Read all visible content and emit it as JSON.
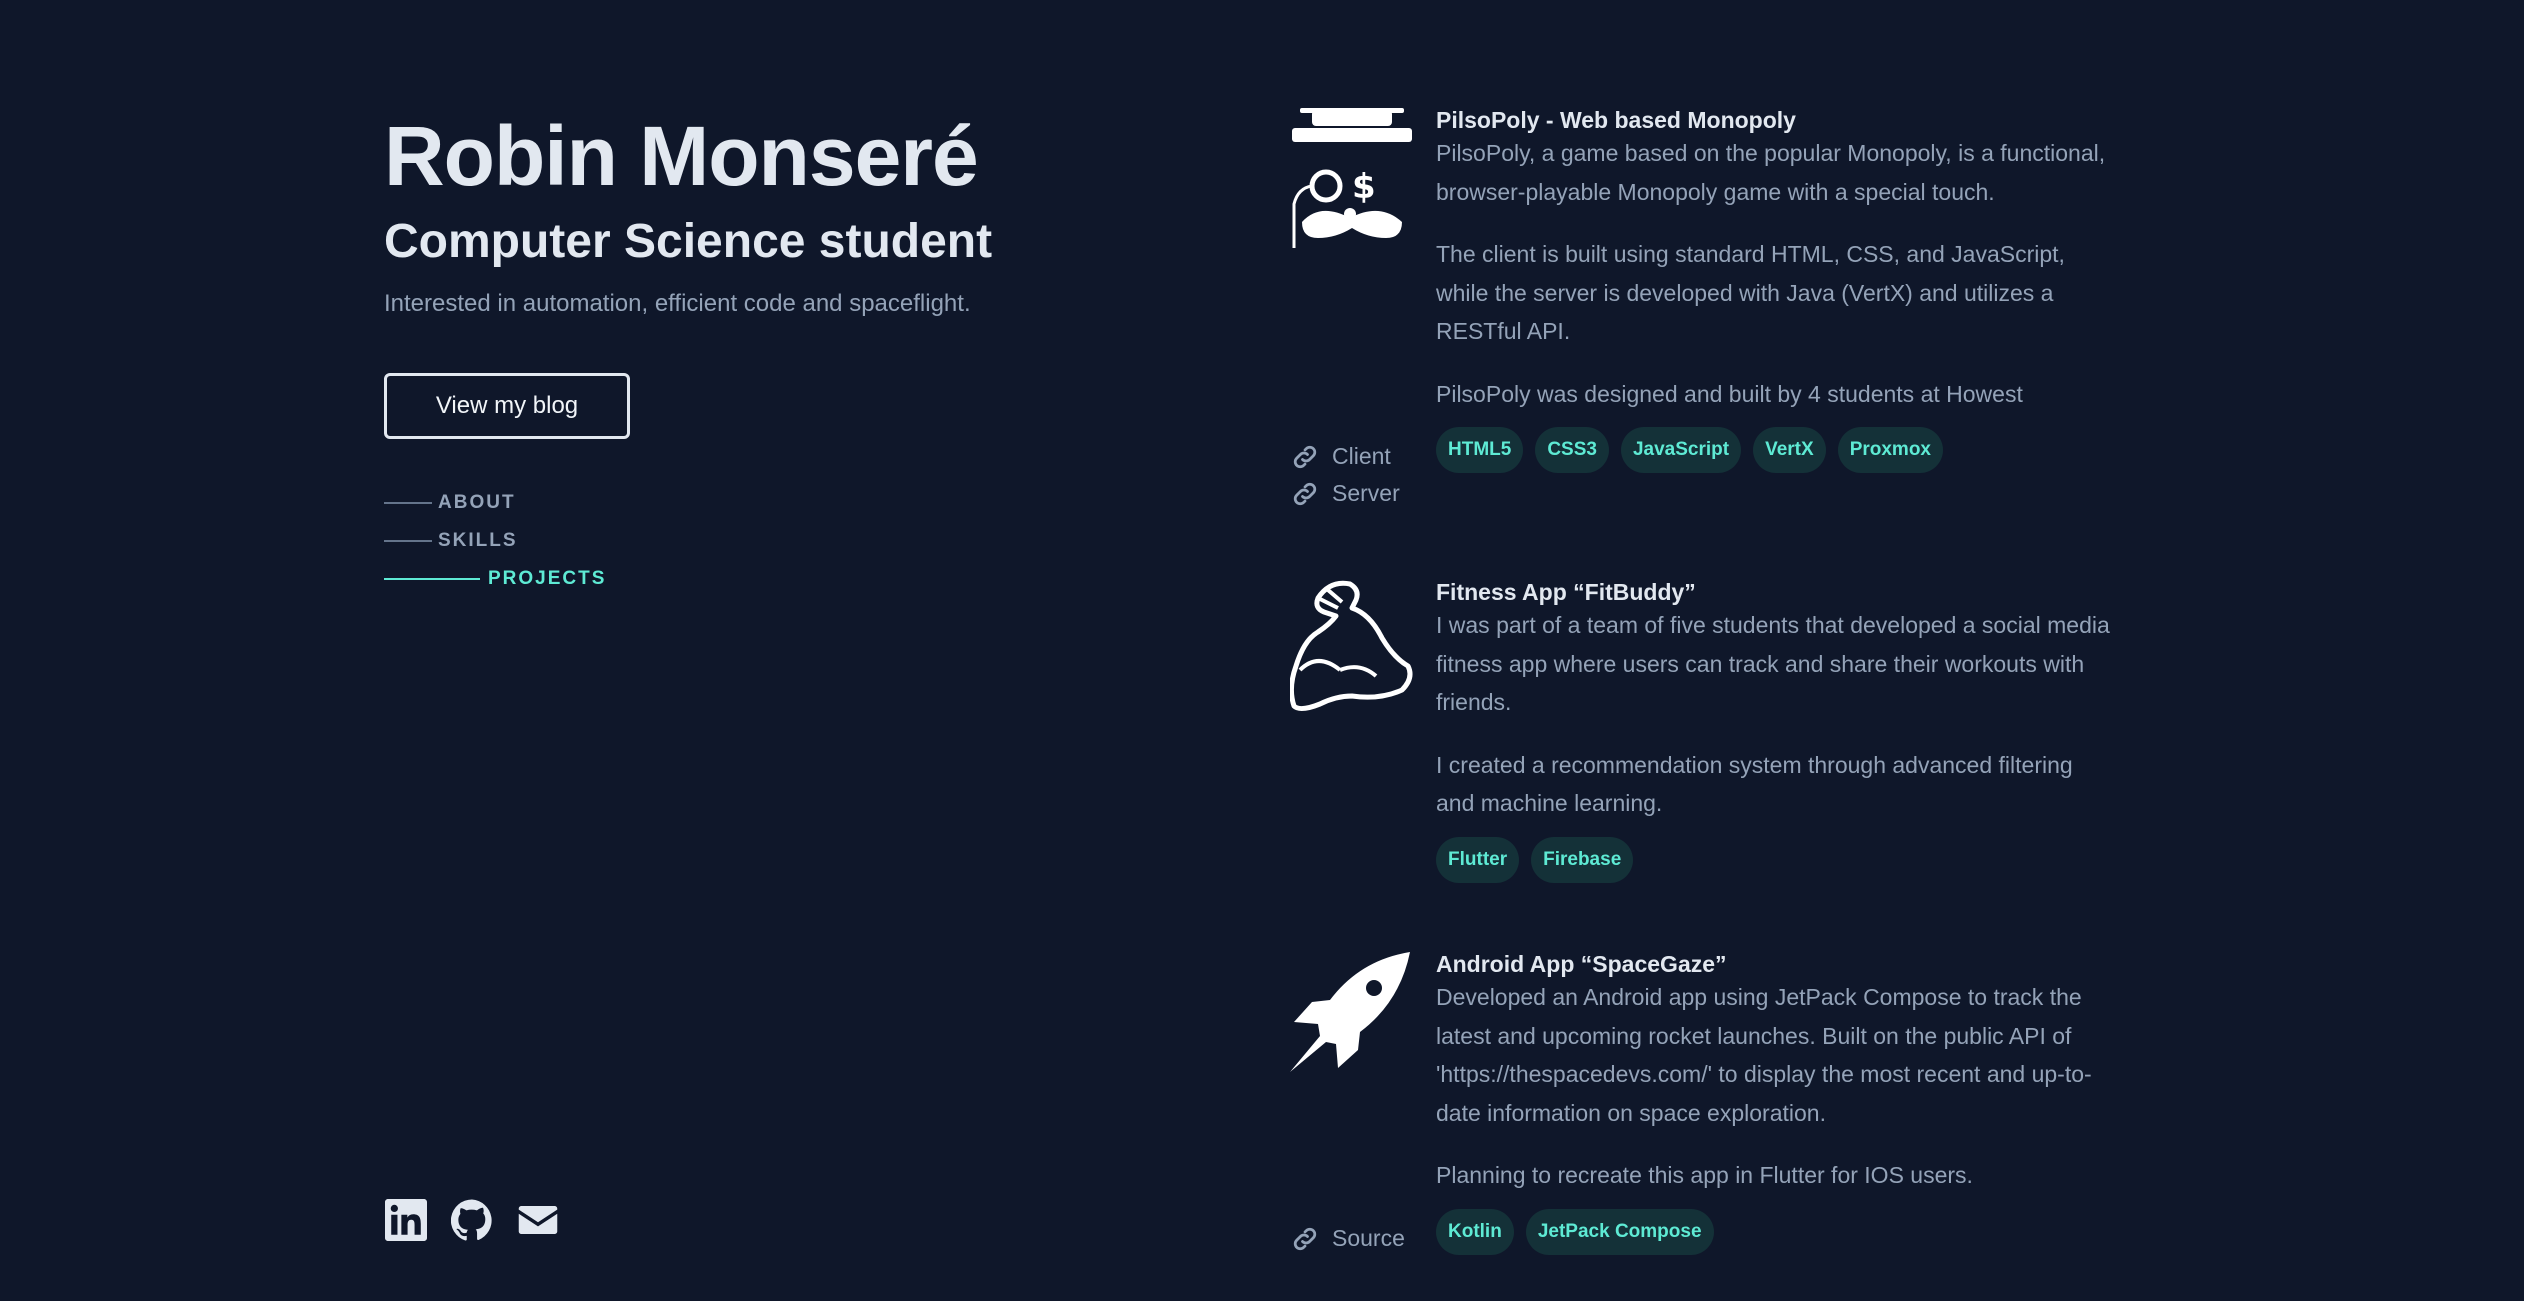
{
  "header": {
    "name": "Robin Monseré",
    "role": "Computer Science student",
    "tagline": "Interested in automation, efficient code and spaceflight.",
    "blog_button": "View my blog"
  },
  "nav": {
    "items": [
      {
        "label": "ABOUT",
        "active": false
      },
      {
        "label": "SKILLS",
        "active": false
      },
      {
        "label": "PROJECTS",
        "active": true
      }
    ]
  },
  "socials": [
    "linkedin-icon",
    "github-icon",
    "mail-icon"
  ],
  "projects": [
    {
      "title": "PilsoPoly - Web based Monopoly",
      "icon": "monopoly-man-icon",
      "paragraphs": [
        "PilsoPoly, a game based on the popular Monopoly, is a functional, browser-playable Monopoly game with a special touch.",
        "The client is built using standard HTML, CSS, and JavaScript, while the server is developed with Java (VertX) and utilizes a RESTful API.",
        "PilsoPoly was designed and built by 4 students at Howest"
      ],
      "links": [
        "Client",
        "Server"
      ],
      "tags": [
        "HTML5",
        "CSS3",
        "JavaScript",
        "VertX",
        "Proxmox"
      ]
    },
    {
      "title": "Fitness App “FitBuddy”",
      "icon": "flexed-bicep-icon",
      "paragraphs": [
        "I was part of a team of five students that developed a social media fitness app where users can track and share their workouts with friends.",
        "I created a recommendation system through advanced filtering and machine learning."
      ],
      "links": [],
      "tags": [
        "Flutter",
        "Firebase"
      ]
    },
    {
      "title": "Android App “SpaceGaze”",
      "icon": "rocket-icon",
      "paragraphs": [
        "Developed an Android app using JetPack Compose to track the latest and upcoming rocket launches. Built on the public API of 'https://thespacedevs.com/' to display the most recent and up-to-date information on space exploration.",
        "Planning to recreate this app in Flutter for IOS users."
      ],
      "links": [
        "Source"
      ],
      "tags": [
        "Kotlin",
        "JetPack Compose"
      ]
    }
  ],
  "colors": {
    "background": "#0f172a",
    "accent": "#5eead4",
    "tag_bg": "#143138",
    "heading": "#e2e8f0",
    "text": "#94a3b8"
  }
}
